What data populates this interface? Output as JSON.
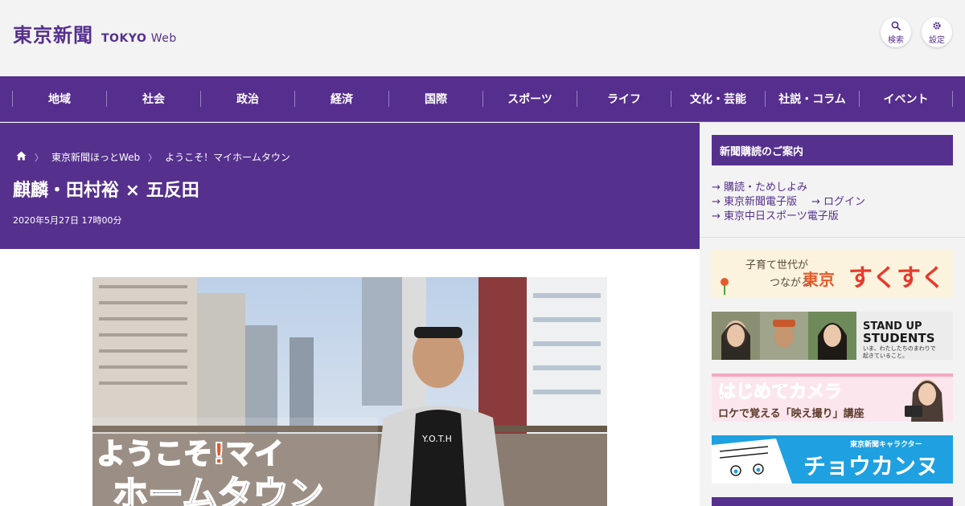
{
  "header": {
    "logo_jp": "東京新聞",
    "logo_en_bold": "TOKYO",
    "logo_en_light": "Web",
    "search_label": "検索",
    "settings_label": "設定"
  },
  "nav": {
    "items": [
      "地域",
      "社会",
      "政治",
      "経済",
      "国際",
      "スポーツ",
      "ライフ",
      "文化・芸能",
      "社説・コラム",
      "イベント"
    ]
  },
  "breadcrumb": {
    "home_icon": "home-icon",
    "items": [
      "東京新聞ほっとWeb",
      "ようこそ！マイホームタウン"
    ]
  },
  "article": {
    "title": "麒麟・田村裕 × 五反田",
    "date": "2020年5月27日 17時00分",
    "image_overlay_line1": "ようこそ!マイ",
    "image_overlay_line2": "ホームタウン",
    "shirt_text": "Y.O.T.H"
  },
  "sidebar": {
    "title": "新聞購読のご案内",
    "links": [
      "→ 購読・ためしよみ",
      "→ 東京新聞電子版",
      "→ ログイン",
      "→ 東京中日スポーツ電子版"
    ],
    "banners": {
      "sukusuku_a": "子育て世代が",
      "sukusuku_b": "つながる",
      "sukusuku_c": "東京",
      "sukusuku_d": "すくすく",
      "standup_1": "STAND UP",
      "standup_2": "STUDENTS",
      "standup_3": "いま、わたしたちのまわりで",
      "standup_4": "起きていること。",
      "camera_1": "はじめてカメラ",
      "camera_2": "ロケで覚える「映え撮り」講座",
      "chokan_1": "東京新聞キャラクター",
      "chokan_2": "チョウカンヌ"
    }
  },
  "colors": {
    "brand": "#55308d",
    "nav_bg": "#552e8e",
    "header_bg": "#f3f3f3",
    "chokan_bg": "#1fa0e0"
  }
}
